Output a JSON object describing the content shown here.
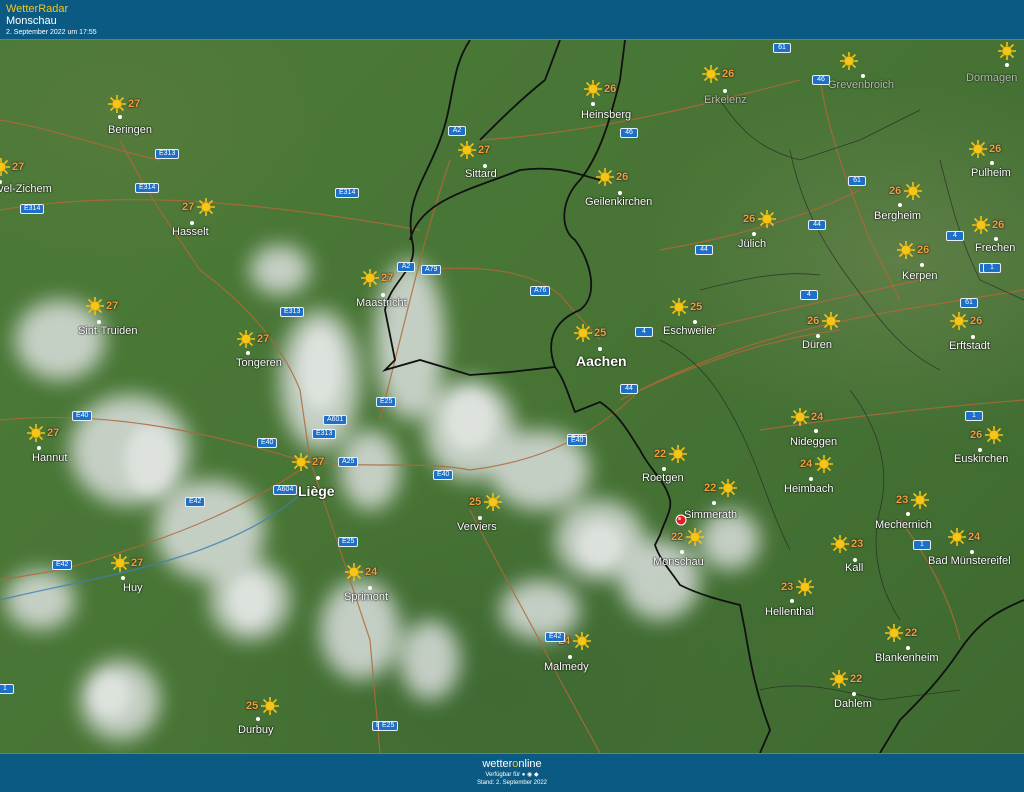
{
  "header": {
    "app_name": "WetterRadar",
    "location": "Monschau",
    "timestamp": "2. September 2022 um 17:55"
  },
  "footer": {
    "logo_left": "wetter",
    "logo_o": "o",
    "logo_right": "nline",
    "available_for": "Verfügbar für",
    "platform_icons": [
      "apple-icon",
      "android-icon",
      "windows-icon"
    ],
    "stand": "Stand: 2. September 2022"
  },
  "colors": {
    "header_bg": "#0b5a84",
    "temp": "#f0a23a",
    "sun": "#f5c518",
    "road_shield": "#1e6fc7",
    "pin": "#e02020"
  },
  "cities": [
    {
      "name": "Beringen",
      "temp": "27",
      "icon": "sun-icon"
    },
    {
      "name": "Hasselt",
      "temp": "27",
      "icon": "sun-icon"
    },
    {
      "name": "vel-Zichem",
      "temp": "27",
      "icon": "sun-icon"
    },
    {
      "name": "Sint-Truiden",
      "temp": "27",
      "icon": "sun-icon"
    },
    {
      "name": "Tongeren",
      "temp": "27",
      "icon": "sun-icon"
    },
    {
      "name": "Hannut",
      "temp": "27",
      "icon": "sun-icon"
    },
    {
      "name": "Liège",
      "temp": "27",
      "icon": "sun-icon"
    },
    {
      "name": "Huy",
      "temp": "27",
      "icon": "sun-icon"
    },
    {
      "name": "Sprimont",
      "temp": "24",
      "icon": "sun-icon"
    },
    {
      "name": "Durbuy",
      "temp": "25",
      "icon": "sun-icon"
    },
    {
      "name": "Verviers",
      "temp": "25",
      "icon": "sun-icon"
    },
    {
      "name": "Malmedy",
      "temp": "24",
      "icon": "sun-icon"
    },
    {
      "name": "Maastricht",
      "temp": "27",
      "icon": "sun-icon"
    },
    {
      "name": "Sittard",
      "temp": "27",
      "icon": "sun-icon"
    },
    {
      "name": "Heinsberg",
      "temp": "26",
      "icon": "sun-icon"
    },
    {
      "name": "Erkelenz",
      "temp": "26",
      "icon": "sun-icon"
    },
    {
      "name": "Grevenbroich",
      "temp": "",
      "icon": "sun-icon"
    },
    {
      "name": "Dormagen",
      "temp": "",
      "icon": "sun-icon"
    },
    {
      "name": "Geilenkirchen",
      "temp": "26",
      "icon": "sun-icon"
    },
    {
      "name": "Pulheim",
      "temp": "26",
      "icon": "sun-icon"
    },
    {
      "name": "Bergheim",
      "temp": "26",
      "icon": "sun-icon"
    },
    {
      "name": "Jülich",
      "temp": "26",
      "icon": "sun-icon"
    },
    {
      "name": "Frechen",
      "temp": "26",
      "icon": "sun-icon"
    },
    {
      "name": "Kerpen",
      "temp": "26",
      "icon": "sun-icon"
    },
    {
      "name": "Aachen",
      "temp": "25",
      "icon": "sun-icon"
    },
    {
      "name": "Eschweiler",
      "temp": "25",
      "icon": "sun-icon"
    },
    {
      "name": "Düren",
      "temp": "26",
      "icon": "sun-icon"
    },
    {
      "name": "Erftstadt",
      "temp": "26",
      "icon": "sun-icon"
    },
    {
      "name": "Nideggen",
      "temp": "24",
      "icon": "sun-icon"
    },
    {
      "name": "Euskirchen",
      "temp": "26",
      "icon": "sun-icon"
    },
    {
      "name": "Roetgen",
      "temp": "22",
      "icon": "sun-icon"
    },
    {
      "name": "Heimbach",
      "temp": "24",
      "icon": "sun-icon"
    },
    {
      "name": "Simmerath",
      "temp": "22",
      "icon": "sun-icon"
    },
    {
      "name": "Mechernich",
      "temp": "23",
      "icon": "sun-icon"
    },
    {
      "name": "Monschau",
      "temp": "22",
      "icon": "sun-icon"
    },
    {
      "name": "Kall",
      "temp": "23",
      "icon": "sun-icon"
    },
    {
      "name": "Bad Münstereifel",
      "temp": "24",
      "icon": "sun-icon"
    },
    {
      "name": "Hellenthal",
      "temp": "23",
      "icon": "sun-icon"
    },
    {
      "name": "Blankenheim",
      "temp": "22",
      "icon": "sun-icon"
    },
    {
      "name": "Dahlem",
      "temp": "22",
      "icon": "sun-icon"
    }
  ],
  "roads": [
    "E314",
    "E313",
    "E314",
    "E314",
    "E313",
    "E40",
    "E40",
    "E313",
    "A601",
    "A25",
    "A604",
    "E42",
    "E42",
    "E25",
    "E25",
    "E40",
    "E40",
    "E42",
    "A2",
    "A2",
    "A79",
    "E25",
    "A76",
    "4",
    "44",
    "44",
    "E40",
    "46",
    "46",
    "61",
    "61",
    "44",
    "4",
    "4",
    "61",
    "1",
    "4",
    "1",
    "1",
    "E25",
    "1"
  ],
  "selected_location": "Monschau"
}
